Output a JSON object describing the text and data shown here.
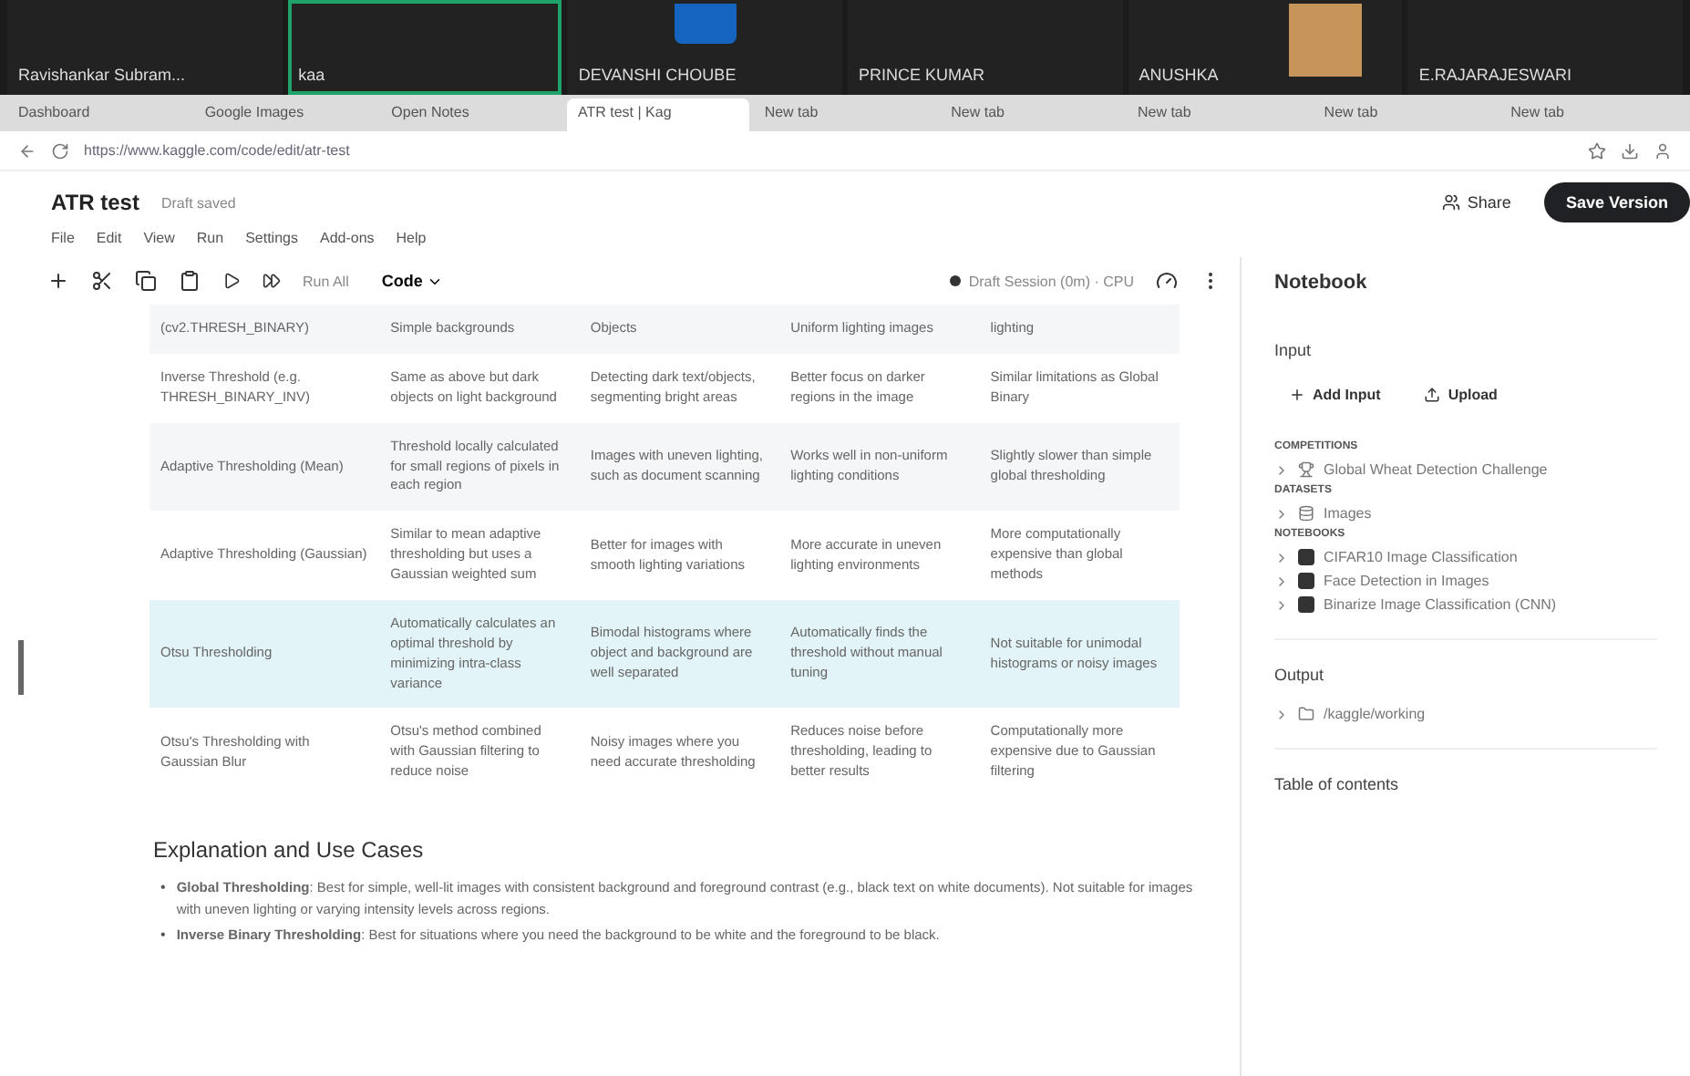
{
  "call_strip": {
    "tiles": [
      {
        "name": "Ravishankar Subram...",
        "kind": "video",
        "speaking": false
      },
      {
        "name": "kaa",
        "kind": "video",
        "speaking": true
      },
      {
        "name": "DEVANSHI CHOUBE",
        "kind": "avatar",
        "speaking": false
      },
      {
        "name": "PRINCE KUMAR",
        "kind": "video",
        "speaking": false
      },
      {
        "name": "ANUSHKA",
        "kind": "photo",
        "speaking": false
      },
      {
        "name": "E.RAJARAJESWARI",
        "kind": "video",
        "speaking": false
      }
    ]
  },
  "browser": {
    "tabs": [
      {
        "label": "Dashboard",
        "selected": false
      },
      {
        "label": "Google Images",
        "selected": false
      },
      {
        "label": "Open Notes",
        "selected": false
      },
      {
        "label": "ATR test | Kag",
        "selected": true
      },
      {
        "label": "New tab",
        "selected": false
      },
      {
        "label": "New tab",
        "selected": false
      },
      {
        "label": "New tab",
        "selected": false
      },
      {
        "label": "New tab",
        "selected": false
      },
      {
        "label": "New tab",
        "selected": false
      }
    ],
    "url": "https://www.kaggle.com/code/edit/atr-test"
  },
  "notebook": {
    "title": "ATR test",
    "status": "Draft saved",
    "menu": [
      "File",
      "Edit",
      "View",
      "Run",
      "Settings",
      "Add-ons",
      "Help"
    ],
    "share": "Share",
    "save": "Save Version",
    "toolbar": {
      "run_all": "Run All",
      "cell_type": "Code",
      "session": "Draft Session (0m) · CPU"
    },
    "table": {
      "rows": [
        {
          "selected": false,
          "cells": [
            "(cv2.THRESH_BINARY)",
            "Simple backgrounds",
            "Objects",
            "Uniform lighting images",
            "lighting"
          ]
        },
        {
          "selected": false,
          "cells": [
            "Inverse Threshold (e.g. THRESH_BINARY_INV)",
            "Same as above but dark objects on light background",
            "Detecting dark text/objects, segmenting bright areas",
            "Better focus on darker regions in the image",
            "Similar limitations as Global Binary"
          ]
        },
        {
          "selected": false,
          "cells": [
            "Adaptive Thresholding (Mean)",
            "Threshold locally calculated for small regions of pixels in each region",
            "Images with uneven lighting, such as document scanning",
            "Works well in non-uniform lighting conditions",
            "Slightly slower than simple global thresholding"
          ]
        },
        {
          "selected": false,
          "cells": [
            "Adaptive Thresholding (Gaussian)",
            "Similar to mean adaptive thresholding but uses a Gaussian weighted sum",
            "Better for images with smooth lighting variations",
            "More accurate in uneven lighting environments",
            "More computationally expensive than global methods"
          ]
        },
        {
          "selected": true,
          "cells": [
            "Otsu Thresholding",
            "Automatically calculates an optimal threshold by minimizing intra-class variance",
            "Bimodal histograms where object and background are well separated",
            "Automatically finds the threshold without manual tuning",
            "Not suitable for unimodal histograms or noisy images"
          ]
        },
        {
          "selected": false,
          "cells": [
            "Otsu's Thresholding with Gaussian Blur",
            "Otsu's method combined with Gaussian filtering to reduce noise",
            "Noisy images where you need accurate thresholding",
            "Reduces noise before thresholding, leading to better results",
            "Computationally more expensive due to Gaussian filtering"
          ]
        }
      ]
    },
    "heading": "Explanation and Use Cases",
    "bullets": [
      {
        "marker": "•",
        "text": "**Global Thresholding**: Best for simple, well-lit images with consistent background and foreground contrast (e.g., black text on white documents). Not suitable for images with uneven lighting or varying intensity levels across regions."
      },
      {
        "marker": "•",
        "text": "**Inverse Binary Thresholding**: Best for situations where you need the background to be white and the foreground to be black."
      }
    ]
  },
  "sidebar": {
    "title": "Notebook",
    "input": {
      "title": "Input",
      "buttons": [
        "Add Input",
        "Upload"
      ],
      "groups": [
        {
          "label": "COMPETITIONS",
          "items": [
            {
              "label": "Global Wheat Detection Challenge",
              "expanded": false
            }
          ]
        },
        {
          "label": "DATASETS",
          "items": [
            {
              "label": "Images",
              "expanded": false
            }
          ]
        },
        {
          "label": "NOTEBOOKS",
          "items": [
            {
              "label": "CIFAR10 Image Classification",
              "expanded": false
            },
            {
              "label": "Face Detection in Images",
              "expanded": false
            },
            {
              "label": "Binarize Image Classification (CNN)",
              "expanded": false
            }
          ]
        }
      ]
    },
    "output": {
      "title": "Output",
      "items": [
        "/kaggle/working"
      ]
    },
    "toc": {
      "title": "Table of contents"
    }
  }
}
